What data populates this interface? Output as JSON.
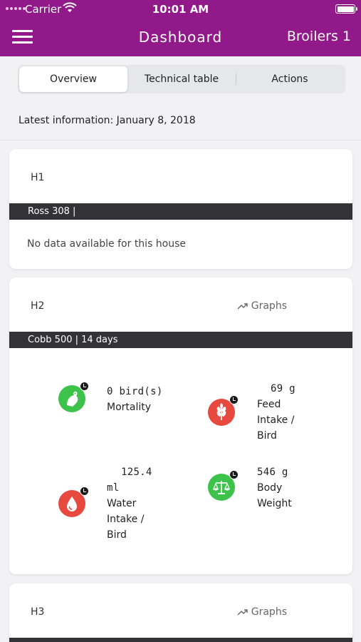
{
  "status_bar": {
    "carrier": "Carrier",
    "time": "10:01 AM"
  },
  "nav": {
    "title": "Dashboard",
    "right_label": "Broilers 1",
    "menu_icon": "hamburger-menu-icon"
  },
  "tabs": [
    {
      "label": "Overview",
      "active": true
    },
    {
      "label": "Technical table",
      "active": false
    },
    {
      "label": "Actions",
      "active": false
    }
  ],
  "latest_info": "Latest information: January 8, 2018",
  "houses": [
    {
      "name": "H1",
      "band": "Ross 308 |",
      "message": "No data available for this house"
    },
    {
      "name": "H2",
      "graphs_label": "Graphs",
      "band": "Cobb 500 |   14 days",
      "kpis": {
        "mortality": {
          "value": "0 bird(s)",
          "label": "Mortality",
          "color": "#3dc24b",
          "icon": "bird-icon"
        },
        "feed": {
          "value": "69 g",
          "label_lines": [
            "Feed",
            "Intake /",
            "Bird"
          ],
          "color": "#e8493f",
          "icon": "wheat-icon"
        },
        "water": {
          "value_lines": [
            "125.4",
            "ml"
          ],
          "label_lines": [
            "Water",
            "Intake /",
            "Bird"
          ],
          "color": "#e8493f",
          "icon": "water-drop-icon"
        },
        "weight": {
          "value": "546 g",
          "label_lines": [
            "Body",
            "Weight"
          ],
          "color": "#3dc24b",
          "icon": "scale-icon"
        }
      }
    },
    {
      "name": "H3",
      "graphs_label": "Graphs"
    }
  ],
  "colors": {
    "brand": "#92198a",
    "band": "#333337",
    "good": "#3dc24b",
    "alert": "#e8493f"
  }
}
